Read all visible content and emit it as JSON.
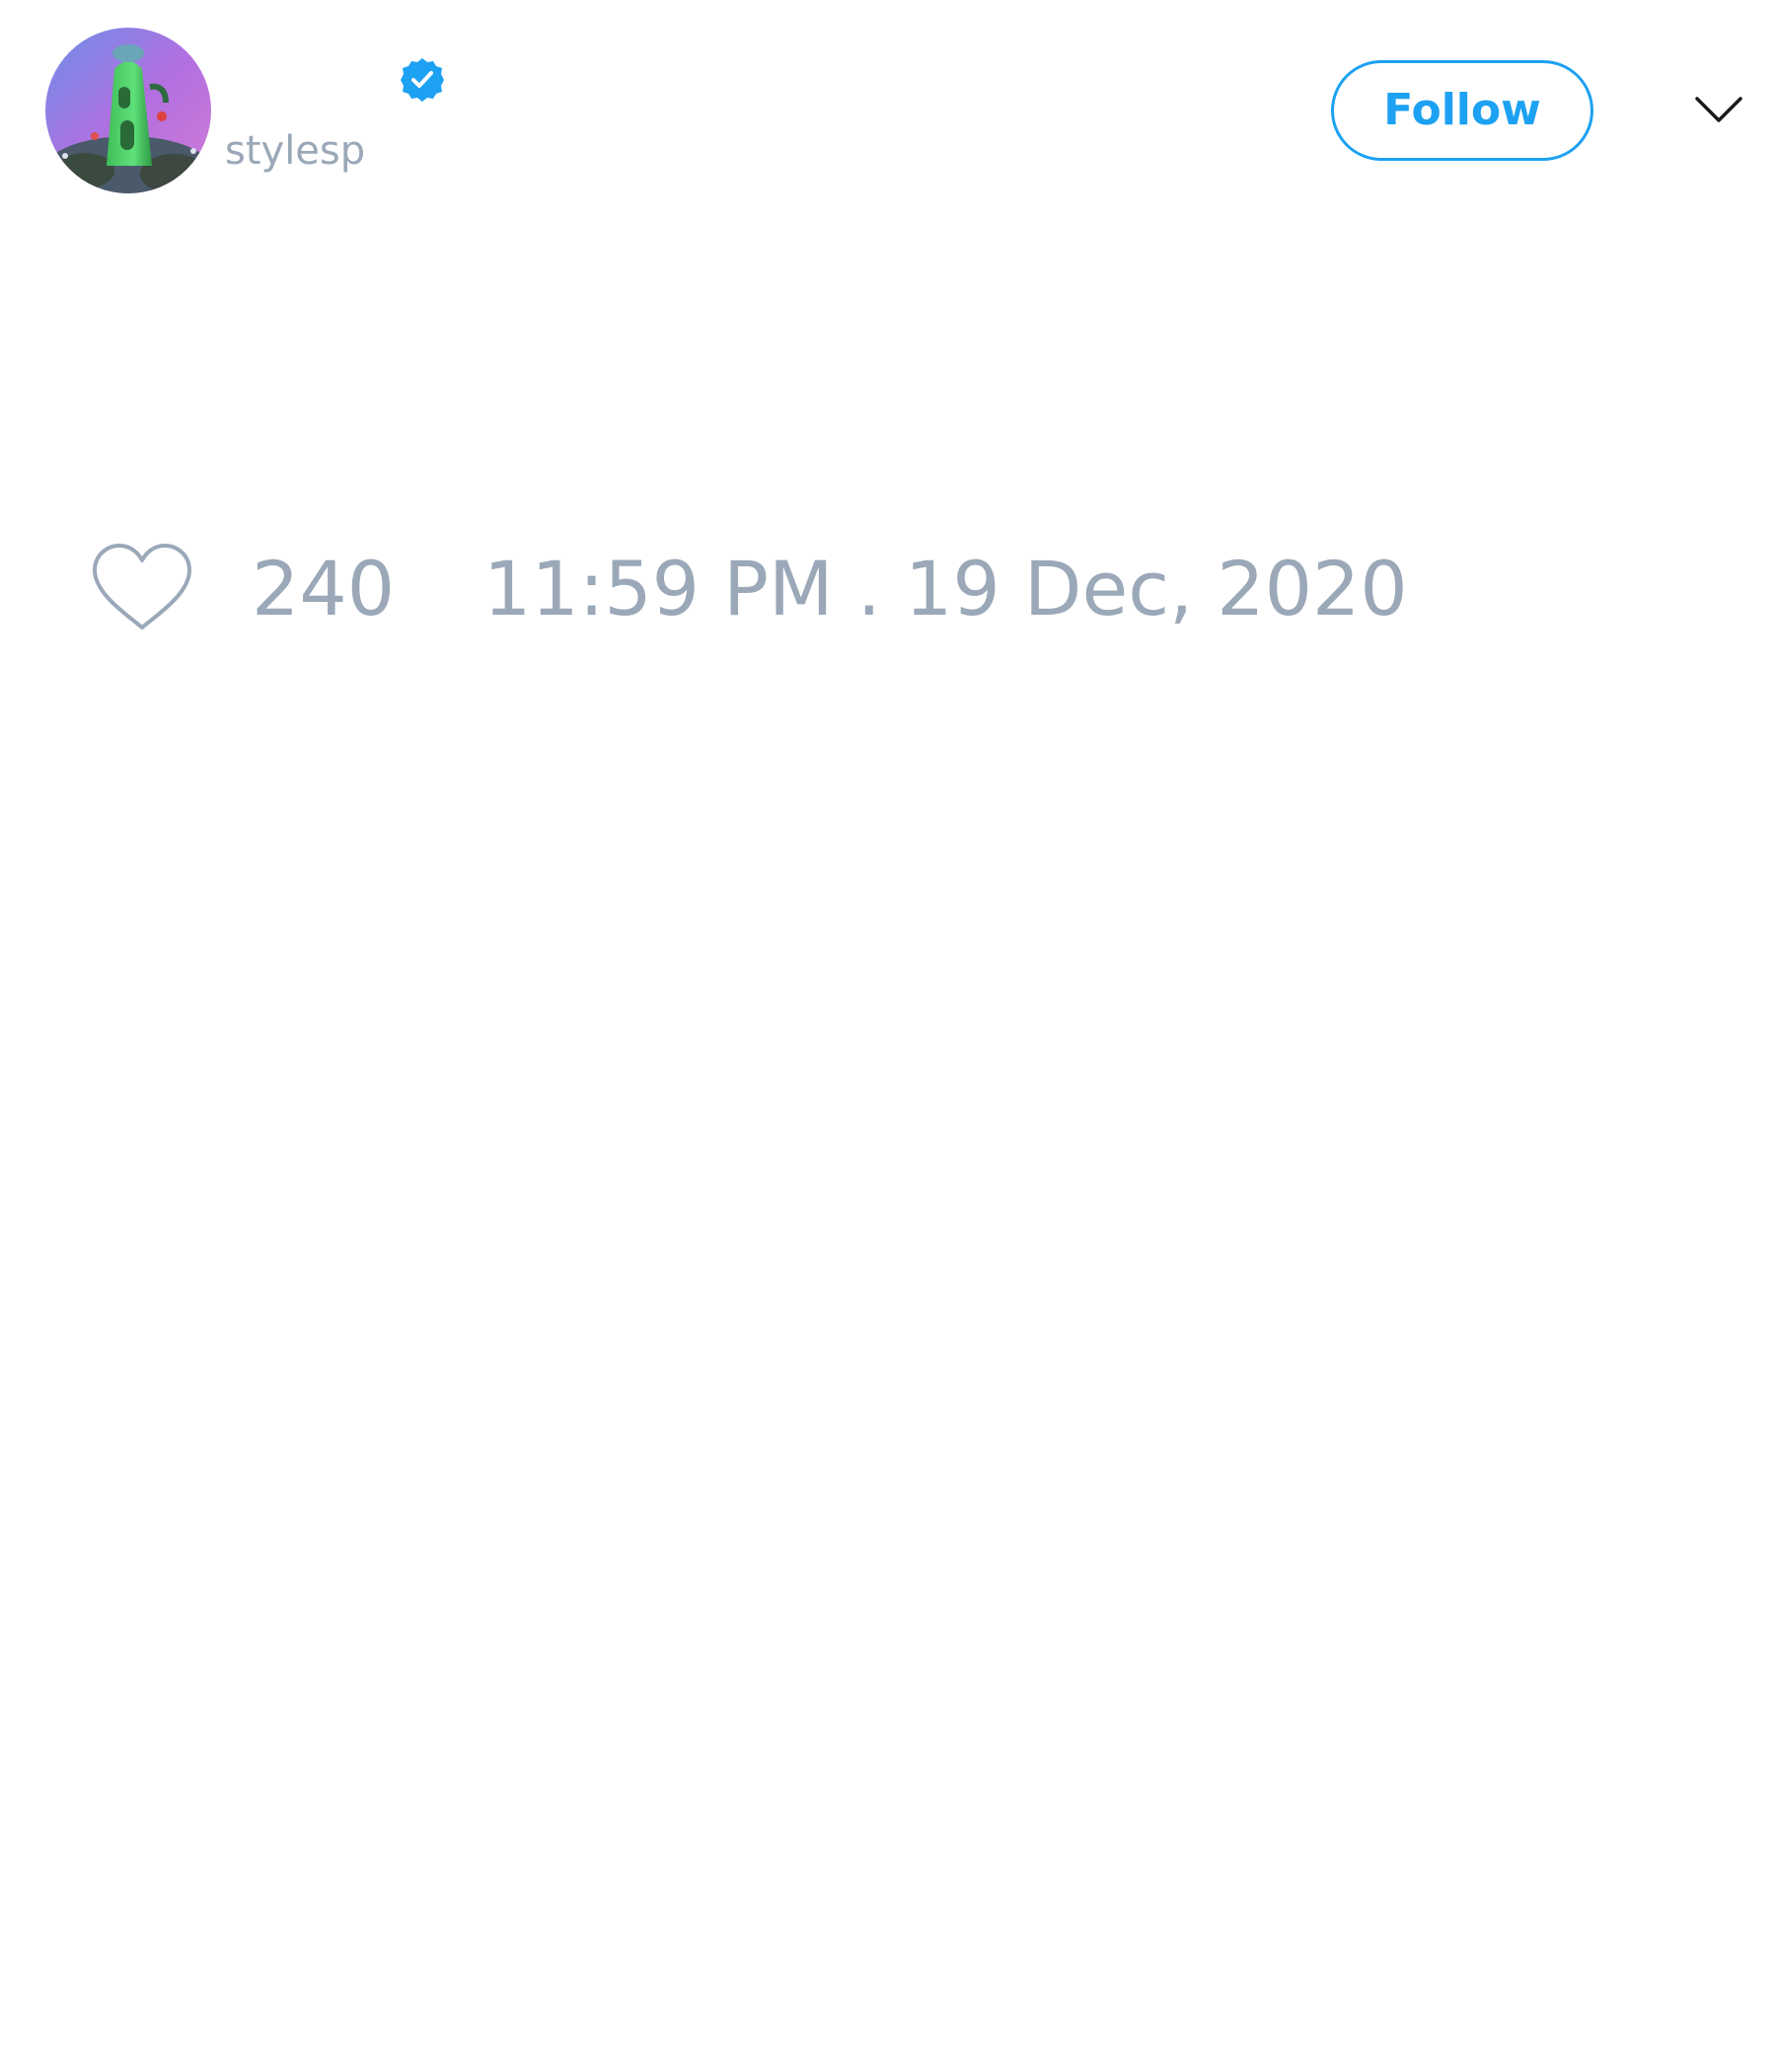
{
  "author": {
    "handle": "stylesp",
    "verified": true,
    "avatar_icon": "cactus-figure-avatar"
  },
  "header": {
    "follow_label": "Follow",
    "menu_icon": "chevron-down-icon"
  },
  "footer": {
    "like_icon": "heart-outline-icon",
    "like_count": "240",
    "timestamp": "11:59 PM . 19 Dec, 2020"
  },
  "colors": {
    "accent": "#1da1f2",
    "muted_text": "#9aa8b8",
    "background": "#ffffff"
  }
}
